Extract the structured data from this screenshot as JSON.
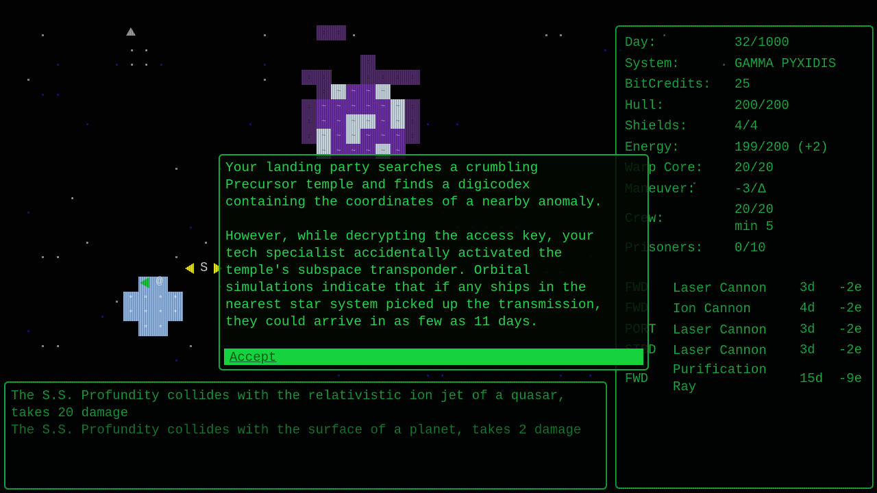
{
  "colors": {
    "terminal_green": "#1fae45",
    "bright_green": "#27d14f",
    "accept_bg": "#17d23f",
    "planet_dark": "#4e2a66",
    "planet_mid": "#6a2fa3",
    "planet_ice": "#c6d4de",
    "ship_blue": "#8fb4e2",
    "marker_yellow": "#e6e016"
  },
  "stats": {
    "day": {
      "label": "Day:",
      "value": "32/1000"
    },
    "system": {
      "label": "System:",
      "value": "GAMMA PYXIDIS"
    },
    "bitcredits": {
      "label": "BitCredits:",
      "value": "25"
    },
    "hull": {
      "label": "Hull:",
      "value": "200/200"
    },
    "shields": {
      "label": "Shields:",
      "value": "4/4"
    },
    "energy": {
      "label": "Energy:",
      "value": "199/200 (+2)"
    },
    "warp_core": {
      "label": "Warp Core:",
      "value": "20/20"
    },
    "maneuver": {
      "label": "Maneuver:",
      "value": "-3/Δ"
    },
    "crew": {
      "label": "Crew:",
      "value": "20/20",
      "value2": "min 5"
    },
    "prisoners": {
      "label": "Prisoners:",
      "value": "0/10"
    }
  },
  "weapons": [
    {
      "slot": "FWD",
      "name": "Laser Cannon",
      "damage": "3d",
      "energy": "-2e"
    },
    {
      "slot": "FWD",
      "name": "Ion Cannon",
      "damage": "4d",
      "energy": "-2e"
    },
    {
      "slot": "PORT",
      "name": "Laser Cannon",
      "damage": "3d",
      "energy": "-2e"
    },
    {
      "slot": "STBD",
      "name": "Laser Cannon",
      "damage": "3d",
      "energy": "-2e"
    },
    {
      "slot": "FWD",
      "name": "Purification Ray",
      "damage": "15d",
      "energy": "-9e"
    }
  ],
  "dialog": {
    "paragraph1": "Your landing party searches a crumbling\nPrecursor temple and finds a digicodex\ncontaining the coordinates of a nearby anomaly.",
    "paragraph2": "However, while decrypting the access key, your\ntech specialist accidentally activated the\ntemple's subspace transponder. Orbital\nsimulations indicate that if any ships in the\nnearest star system picked up the transmission,\nthey could arrive in as few as 11 days.",
    "accept_label": "Accept"
  },
  "log": [
    "The S.S. Profundity collides with the relativistic ion jet of a quasar, takes 20 damage",
    "The S.S. Profundity collides with the surface of a planet, takes 2 damage"
  ],
  "map": {
    "player_symbol": "@",
    "ship_cell_glyph": "*",
    "planet_glyph": "~",
    "target_marker": "S",
    "object_triangle": "▲"
  }
}
